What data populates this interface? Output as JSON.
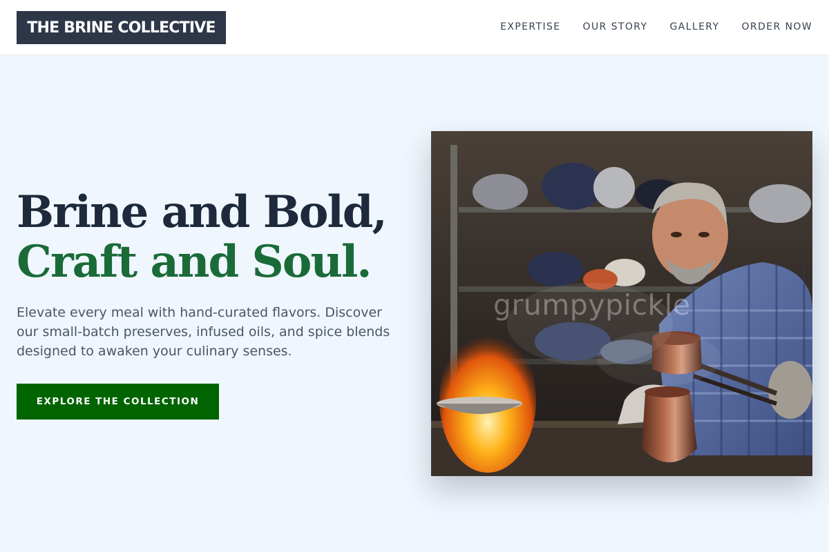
{
  "brand": {
    "name": "THE BRINE COLLECTIVE"
  },
  "nav": {
    "items": [
      {
        "label": "EXPERTISE"
      },
      {
        "label": "OUR STORY"
      },
      {
        "label": "GALLERY"
      },
      {
        "label": "ORDER NOW"
      }
    ]
  },
  "hero": {
    "title_line1": "Brine and Bold,",
    "title_line2": "Craft and Soul.",
    "description": "Elevate every meal with hand-curated flavors. Discover our small-batch preserves, infused oils, and spice blends designed to awaken your culinary senses.",
    "cta_label": "EXPLORE THE COLLECTION"
  },
  "image": {
    "watermark": "grumpypickle"
  },
  "colors": {
    "background": "#eff6fd",
    "logo_bg": "#2d3748",
    "heading": "#1e293b",
    "accent_green": "#1a6b38",
    "button_green": "#006400",
    "body_text": "#4b5563"
  }
}
